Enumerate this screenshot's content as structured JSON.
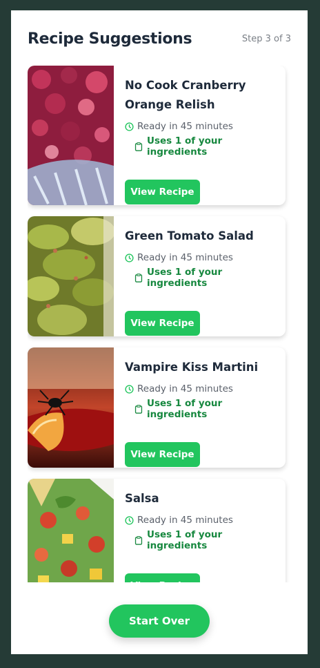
{
  "header": {
    "title": "Recipe Suggestions",
    "step": "Step 3 of 3"
  },
  "recipes": [
    {
      "name_line1": "No Cook Cranberry",
      "name_line2": "Orange Relish",
      "time": "Ready in 45 minutes",
      "uses": "Uses 1 of your ingredients",
      "button": "View Recipe"
    },
    {
      "name_line1": "Green Tomato Salad",
      "time": "Ready in 45 minutes",
      "uses": "Uses 1 of your ingredients",
      "button": "View Recipe"
    },
    {
      "name_line1": "Vampire Kiss Martini",
      "time": "Ready in 45 minutes",
      "uses": "Uses 1 of your ingredients",
      "button": "View Recipe"
    },
    {
      "name_line1": "Salsa",
      "time": "Ready in 45 minutes",
      "uses": "Uses 1 of your ingredients",
      "button": "View Recipe"
    }
  ],
  "footer": {
    "start_over": "Start Over"
  },
  "colors": {
    "accent": "#22c55e",
    "ingredient_text": "#17883f",
    "background": "#253b36"
  }
}
